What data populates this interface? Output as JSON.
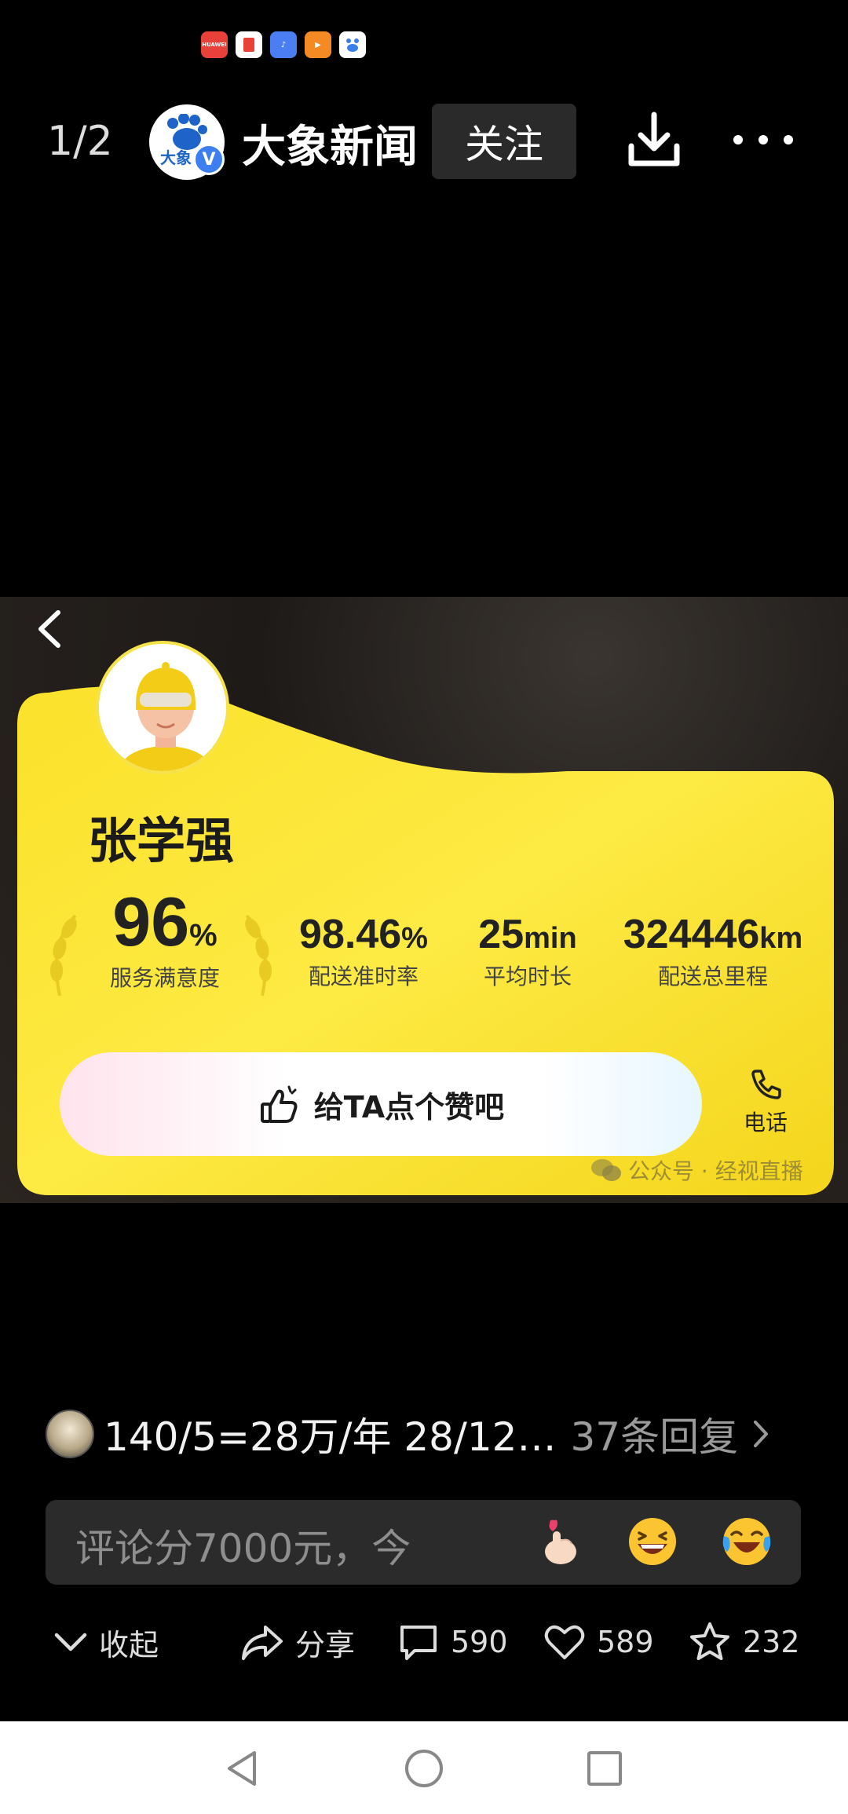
{
  "status_bar": {
    "apps": [
      {
        "icon": "huawei-appgallery-icon",
        "color": "#e8413a",
        "label": "HUAWEI"
      },
      {
        "icon": "book-app-icon",
        "color": "#e8413a",
        "label": ""
      },
      {
        "icon": "music-app-icon",
        "color": "#4a7ef2",
        "label": ""
      },
      {
        "icon": "video-app-icon",
        "color": "#f38a24",
        "label": ""
      },
      {
        "icon": "baidu-app-icon",
        "color": "#3a7ee8",
        "label": ""
      }
    ]
  },
  "header": {
    "page_indicator": "1/2",
    "account_name": "大象新闻",
    "avatar_text": "大象",
    "verified_badge": "V",
    "follow_label": "关注"
  },
  "image": {
    "rider_name": "张学强",
    "stats": [
      {
        "value": "96",
        "unit": "%",
        "label": "服务满意度"
      },
      {
        "value": "98.46",
        "unit": "%",
        "label": "配送准时率"
      },
      {
        "value": "25",
        "unit": "min",
        "label": "平均时长"
      },
      {
        "value": "324446",
        "unit": "km",
        "label": "配送总里程"
      }
    ],
    "like_label": "给TA点个赞吧",
    "phone_label": "电话",
    "watermark": "公众号 · 经视直播"
  },
  "comment_preview": {
    "text": "140/5=28万/年 28/12…",
    "reply_count": "37条回复"
  },
  "comment_input": {
    "placeholder": "评论分7000元，今",
    "emojis": [
      "finger-heart-emoji",
      "grinning-squint-emoji",
      "crying-laughing-emoji"
    ]
  },
  "actions": {
    "collapse": "收起",
    "share": "分享",
    "comments": "590",
    "likes": "589",
    "favorites": "232"
  },
  "colors": {
    "card_yellow": "#fbe32a",
    "follow_bg": "#2a2a2a",
    "input_bg": "#2b2b2b",
    "verified_blue": "#3d7ff0"
  }
}
